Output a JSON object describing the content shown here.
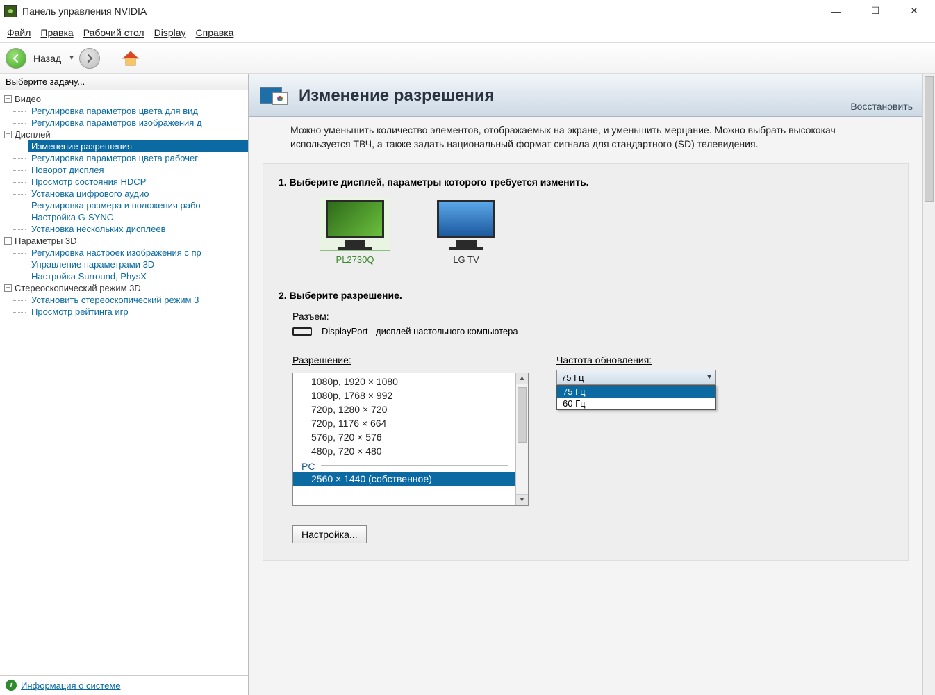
{
  "window": {
    "title": "Панель управления NVIDIA"
  },
  "menubar": {
    "file": "Файл",
    "edit": "Правка",
    "desktop": "Рабочий стол",
    "display": "Display",
    "help": "Справка"
  },
  "toolbar": {
    "back_label": "Назад"
  },
  "sidebar": {
    "header": "Выберите задачу...",
    "footer_link": "Информация о системе",
    "tree": {
      "video": {
        "label": "Видео",
        "items": [
          "Регулировка параметров цвета для вид",
          "Регулировка параметров изображения д"
        ]
      },
      "display": {
        "label": "Дисплей",
        "items": [
          "Изменение разрешения",
          "Регулировка параметров цвета рабочег",
          "Поворот дисплея",
          "Просмотр состояния HDCP",
          "Установка цифрового аудио",
          "Регулировка размера и положения рабо",
          "Настройка G-SYNC",
          "Установка нескольких дисплеев"
        ]
      },
      "params3d": {
        "label": "Параметры 3D",
        "items": [
          "Регулировка настроек изображения с пр",
          "Управление параметрами 3D",
          "Настройка Surround, PhysX"
        ]
      },
      "stereo3d": {
        "label": "Стереоскопический режим 3D",
        "items": [
          "Установить стереоскопический режим 3",
          "Просмотр рейтинга игр"
        ]
      }
    }
  },
  "content": {
    "title": "Изменение разрешения",
    "restore": "Восстановить",
    "description": "Можно уменьшить количество элементов, отображаемых на экране, и уменьшить мерцание. Можно выбрать высококач используется ТВЧ, а также задать национальный формат сигнала для стандартного (SD) телевидения.",
    "step1_title": "1. Выберите дисплей, параметры которого требуется изменить.",
    "displays": [
      {
        "name": "PL2730Q",
        "selected": true
      },
      {
        "name": "LG TV",
        "selected": false
      }
    ],
    "step2_title": "2. Выберите разрешение.",
    "connector_label": "Разъем:",
    "connector_value": "DisplayPort - дисплей настольного компьютера",
    "resolution_label": "Разрешение:",
    "resolution_options": [
      "1080p, 1920 × 1080",
      "1080p, 1768 × 992",
      "720p, 1280 × 720",
      "720p, 1176 × 664",
      "576p, 720 × 576",
      "480p, 720 × 480"
    ],
    "resolution_group": "PC",
    "resolution_selected": "2560 × 1440 (собственное)",
    "refresh_label": "Частота обновления:",
    "refresh_selected": "75 Гц",
    "refresh_options": [
      "75 Гц",
      "60 Гц"
    ],
    "customize_button": "Настройка..."
  }
}
